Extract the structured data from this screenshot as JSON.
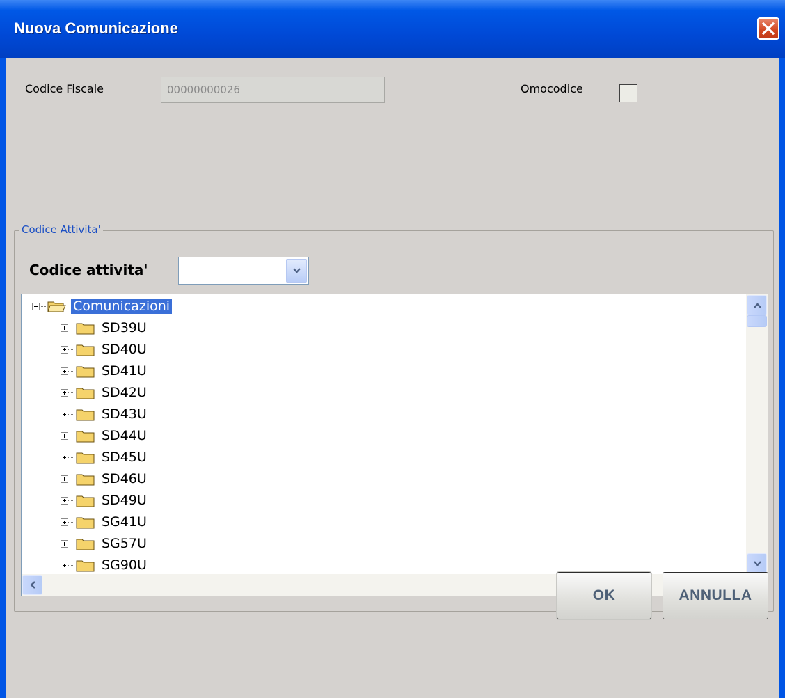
{
  "window": {
    "title": "Nuova Comunicazione"
  },
  "form": {
    "codice_fiscale_label": "Codice Fiscale",
    "codice_fiscale_value": "00000000026",
    "omocodice_label": "Omocodice",
    "omocodice_checked": false
  },
  "attivita": {
    "group_label": "Codice Attivita'",
    "codice_label": "Codice attivita'",
    "codice_value": ""
  },
  "tree": {
    "root": "Comunicazioni",
    "children": [
      "SD39U",
      "SD40U",
      "SD41U",
      "SD42U",
      "SD43U",
      "SD44U",
      "SD45U",
      "SD46U",
      "SD49U",
      "SG41U",
      "SG57U",
      "SG90U"
    ]
  },
  "buttons": {
    "ok": "OK",
    "annulla": "ANNULLA"
  },
  "colors": {
    "titlebar": "#0058e6",
    "selection": "#3a6fd8",
    "legend": "#1b4fc4",
    "folder": "#f5d36b"
  }
}
